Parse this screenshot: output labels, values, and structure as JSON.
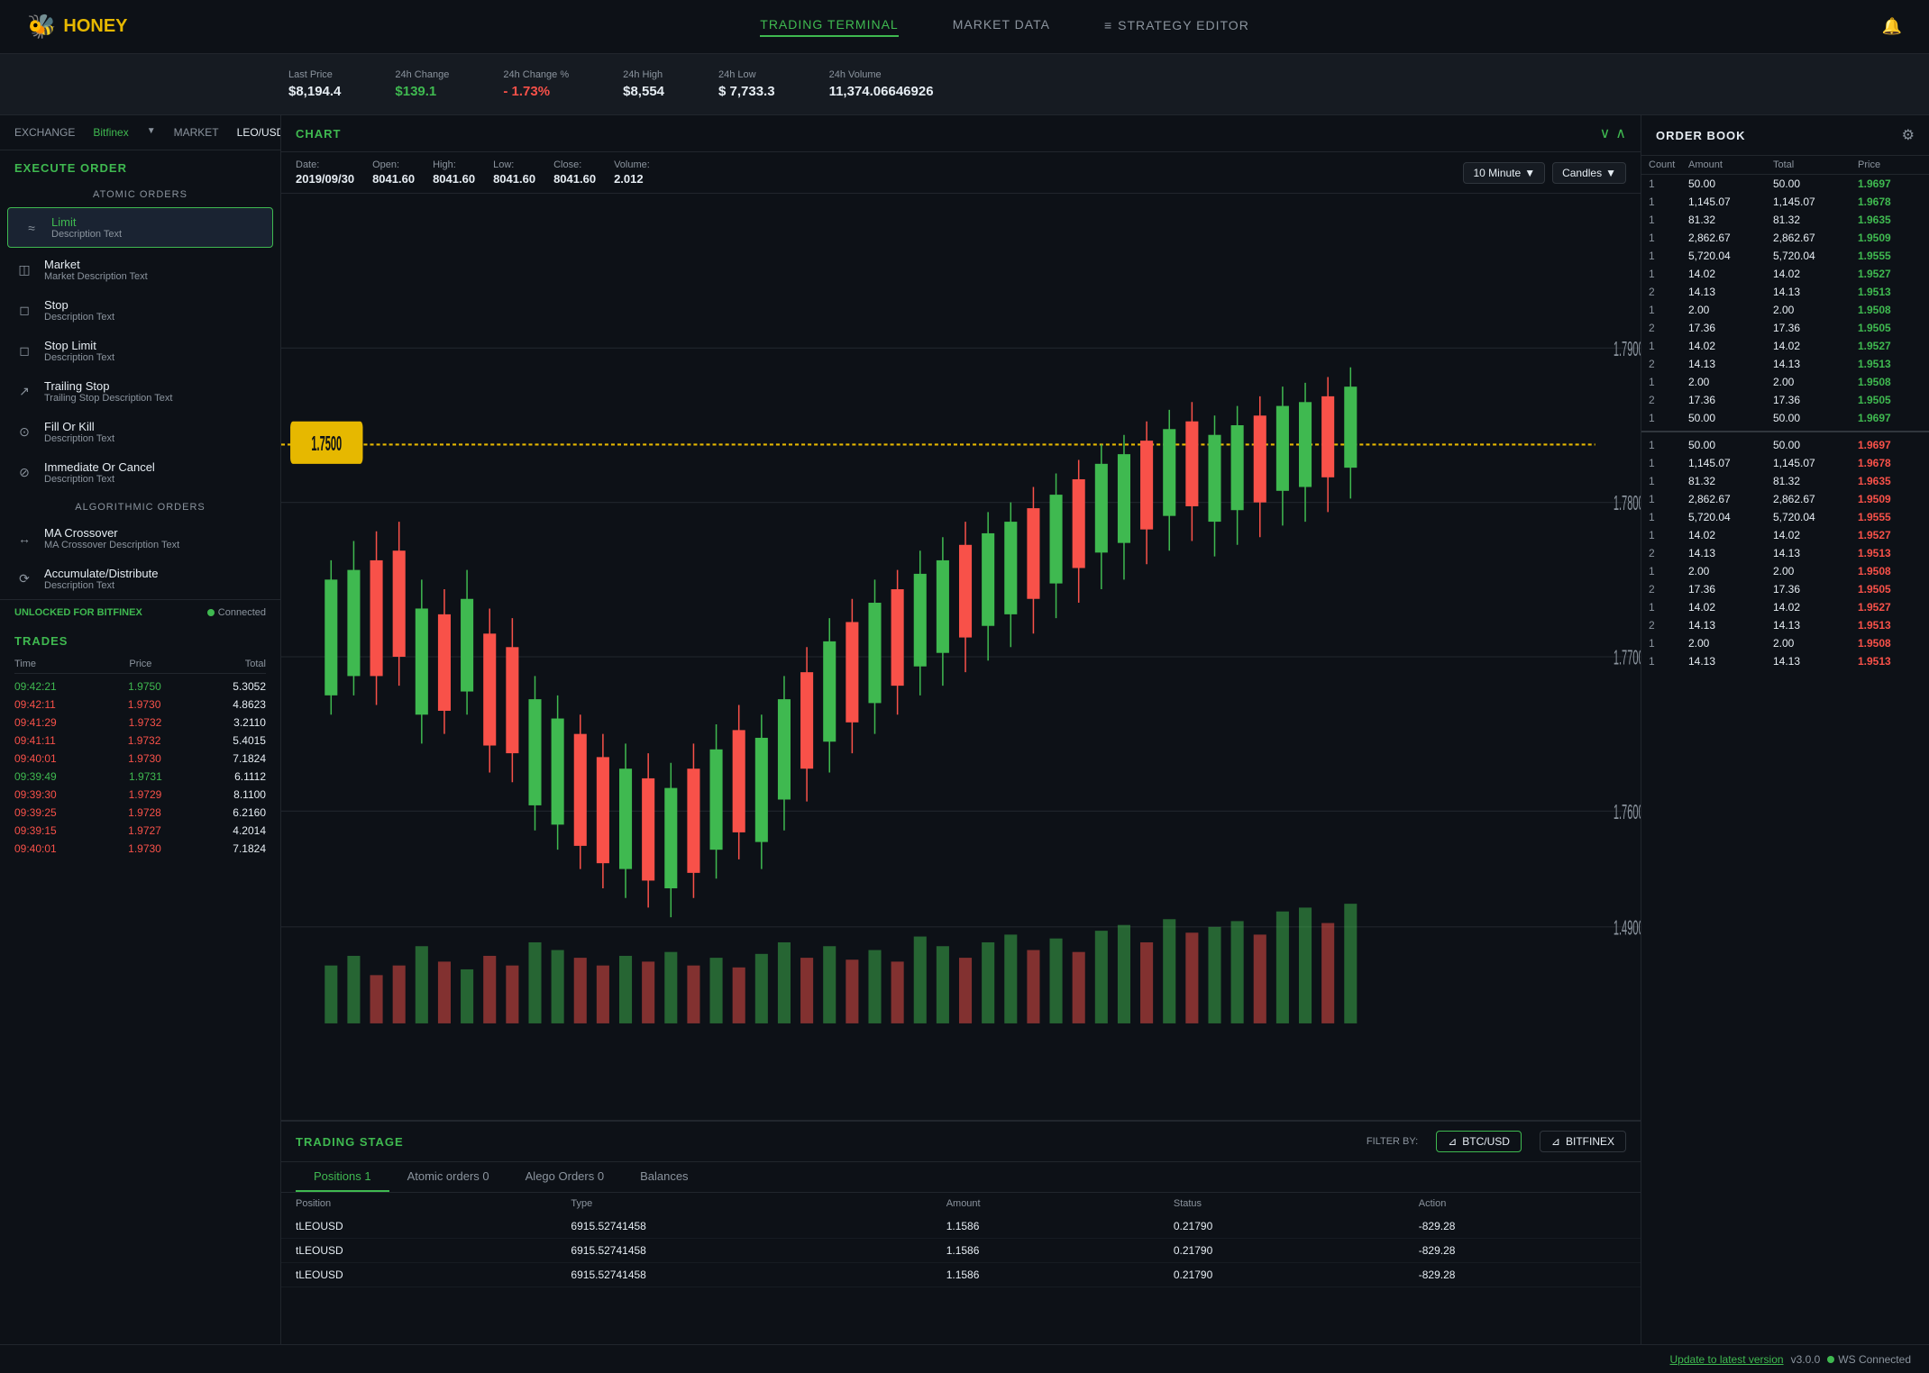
{
  "app": {
    "name": "HONEY",
    "logo_emoji": "🐝"
  },
  "nav": {
    "tabs": [
      {
        "label": "TRADING TERMINAL",
        "active": true
      },
      {
        "label": "MARKET DATA",
        "active": false
      },
      {
        "label": "STRATEGY EDITOR",
        "active": false
      }
    ]
  },
  "ticker": {
    "last_price_label": "Last Price",
    "last_price_value": "$8,194.4",
    "change_label": "24h Change",
    "change_value": "$139.1",
    "change_pct_label": "24h Change %",
    "change_pct_value": "- 1.73%",
    "high_label": "24h High",
    "high_value": "$8,554",
    "low_label": "24h Low",
    "low_value": "$ 7,733.3",
    "volume_label": "24h Volume",
    "volume_value": "11,374.06646926"
  },
  "exchange_bar": {
    "exchange_label": "EXCHANGE",
    "exchange_value": "Bitfinex",
    "market_label": "MARKET",
    "market_value": "LEO/USD"
  },
  "sidebar": {
    "execute_order_title": "EXECUTE ORDER",
    "atomic_orders_title": "ATOMIC ORDERS",
    "atomic_orders": [
      {
        "icon": "≈",
        "title": "Limit",
        "desc": "Description Text",
        "active": true
      },
      {
        "icon": "◫",
        "title": "Market",
        "desc": "Market Description Text",
        "active": false
      },
      {
        "icon": "◻",
        "title": "Stop",
        "desc": "Description Text",
        "active": false
      },
      {
        "icon": "◻",
        "title": "Stop Limit",
        "desc": "Description Text",
        "active": false
      },
      {
        "icon": "↗",
        "title": "Trailing Stop",
        "desc": "Trailing Stop Description Text",
        "active": false
      },
      {
        "icon": "⊙",
        "title": "Fill Or Kill",
        "desc": "Description Text",
        "active": false
      },
      {
        "icon": "⊘",
        "title": "Immediate Or Cancel",
        "desc": "Description Text",
        "active": false
      }
    ],
    "algo_orders_title": "ALGORITHMIC ORDERS",
    "algo_orders": [
      {
        "icon": "↔",
        "title": "MA Crossover",
        "desc": "MA Crossover Description Text",
        "active": false
      },
      {
        "icon": "⟳",
        "title": "Accumulate/Distribute",
        "desc": "Description Text",
        "active": false
      }
    ],
    "unlocked_text": "UNLOCKED FOR BITFINEX",
    "connected_text": "Connected"
  },
  "trades": {
    "title": "TRADES",
    "headers": [
      "Time",
      "Price",
      "Total"
    ],
    "rows": [
      {
        "time": "09:42:21",
        "price": "1.9750",
        "total": "5.3052",
        "color": "green"
      },
      {
        "time": "09:42:11",
        "price": "1.9730",
        "total": "4.8623",
        "color": "red"
      },
      {
        "time": "09:41:29",
        "price": "1.9732",
        "total": "3.2110",
        "color": "red"
      },
      {
        "time": "09:41:11",
        "price": "1.9732",
        "total": "5.4015",
        "color": "red"
      },
      {
        "time": "09:40:01",
        "price": "1.9730",
        "total": "7.1824",
        "color": "red"
      },
      {
        "time": "09:39:49",
        "price": "1.9731",
        "total": "6.1112",
        "color": "green"
      },
      {
        "time": "09:39:30",
        "price": "1.9729",
        "total": "8.1100",
        "color": "red"
      },
      {
        "time": "09:39:25",
        "price": "1.9728",
        "total": "6.2160",
        "color": "red"
      },
      {
        "time": "09:39:15",
        "price": "1.9727",
        "total": "4.2014",
        "color": "red"
      },
      {
        "time": "09:40:01",
        "price": "1.9730",
        "total": "7.1824",
        "color": "red"
      }
    ]
  },
  "chart": {
    "title": "CHART",
    "date_label": "Date:",
    "date_value": "2019/09/30",
    "open_label": "Open:",
    "open_value": "8041.60",
    "high_label": "High:",
    "high_value": "8041.60",
    "low_label": "Low:",
    "low_value": "8041.60",
    "close_label": "Close:",
    "close_value": "8041.60",
    "volume_label": "Volume:",
    "volume_value": "2.012",
    "timeframe": "10 Minute",
    "chart_type": "Candles",
    "price_marker": "1.7500"
  },
  "trading_stage": {
    "title": "TRADING STAGE",
    "filter_by_label": "FILTER BY:",
    "filter_btcusd": "BTC/USD",
    "filter_bitfinex": "BITFINEX",
    "tabs": [
      {
        "label": "Positions 1",
        "active": true
      },
      {
        "label": "Atomic orders 0",
        "active": false
      },
      {
        "label": "Alego Orders 0",
        "active": false
      },
      {
        "label": "Balances",
        "active": false
      }
    ],
    "table_headers": [
      "Position",
      "Type",
      "Amount",
      "Status",
      "Action"
    ],
    "rows": [
      {
        "position": "tLEOUSD",
        "type": "6915.52741458",
        "amount": "1.1586",
        "status": "0.21790",
        "action": "-829.28"
      },
      {
        "position": "tLEOUSD",
        "type": "6915.52741458",
        "amount": "1.1586",
        "status": "0.21790",
        "action": "-829.28"
      },
      {
        "position": "tLEOUSD",
        "type": "6915.52741458",
        "amount": "1.1586",
        "status": "0.21790",
        "action": "-829.28"
      }
    ]
  },
  "order_book": {
    "title": "ORDER BOOK",
    "headers": [
      "Count",
      "Amount",
      "Total",
      "Price"
    ],
    "ask_rows": [
      {
        "count": "1",
        "amount": "50.00",
        "total": "50.00",
        "price": "1.9697"
      },
      {
        "count": "1",
        "amount": "1,145.07",
        "total": "1,145.07",
        "price": "1.9678"
      },
      {
        "count": "1",
        "amount": "81.32",
        "total": "81.32",
        "price": "1.9635"
      },
      {
        "count": "1",
        "amount": "2,862.67",
        "total": "2,862.67",
        "price": "1.9509"
      },
      {
        "count": "1",
        "amount": "5,720.04",
        "total": "5,720.04",
        "price": "1.9555"
      },
      {
        "count": "1",
        "amount": "14.02",
        "total": "14.02",
        "price": "1.9527"
      },
      {
        "count": "2",
        "amount": "14.13",
        "total": "14.13",
        "price": "1.9513"
      },
      {
        "count": "1",
        "amount": "2.00",
        "total": "2.00",
        "price": "1.9508"
      },
      {
        "count": "2",
        "amount": "17.36",
        "total": "17.36",
        "price": "1.9505"
      },
      {
        "count": "1",
        "amount": "14.02",
        "total": "14.02",
        "price": "1.9527"
      },
      {
        "count": "2",
        "amount": "14.13",
        "total": "14.13",
        "price": "1.9513"
      },
      {
        "count": "1",
        "amount": "2.00",
        "total": "2.00",
        "price": "1.9508"
      },
      {
        "count": "2",
        "amount": "17.36",
        "total": "17.36",
        "price": "1.9505"
      }
    ],
    "mid_row": {
      "count": "1",
      "amount": "50.00",
      "total": "50.00",
      "price": "1.9697"
    },
    "bid_rows": [
      {
        "count": "1",
        "amount": "50.00",
        "total": "50.00",
        "price": "1.9697"
      },
      {
        "count": "1",
        "amount": "1,145.07",
        "total": "1,145.07",
        "price": "1.9678"
      },
      {
        "count": "1",
        "amount": "81.32",
        "total": "81.32",
        "price": "1.9635"
      },
      {
        "count": "1",
        "amount": "2,862.67",
        "total": "2,862.67",
        "price": "1.9509"
      },
      {
        "count": "1",
        "amount": "5,720.04",
        "total": "5,720.04",
        "price": "1.9555"
      },
      {
        "count": "1",
        "amount": "14.02",
        "total": "14.02",
        "price": "1.9527"
      },
      {
        "count": "2",
        "amount": "14.13",
        "total": "14.13",
        "price": "1.9513"
      },
      {
        "count": "1",
        "amount": "2.00",
        "total": "2.00",
        "price": "1.9508"
      },
      {
        "count": "2",
        "amount": "17.36",
        "total": "17.36",
        "price": "1.9505"
      },
      {
        "count": "1",
        "amount": "14.02",
        "total": "14.02",
        "price": "1.9527"
      },
      {
        "count": "2",
        "amount": "14.13",
        "total": "14.13",
        "price": "1.9513"
      },
      {
        "count": "1",
        "amount": "2.00",
        "total": "2.00",
        "price": "1.9508"
      },
      {
        "count": "1",
        "amount": "14.13",
        "total": "14.13",
        "price": "1.9513"
      }
    ]
  },
  "bottom_bar": {
    "update_text": "Update to latest version",
    "version": "v3.0.0",
    "ws_connected": "WS Connected"
  }
}
